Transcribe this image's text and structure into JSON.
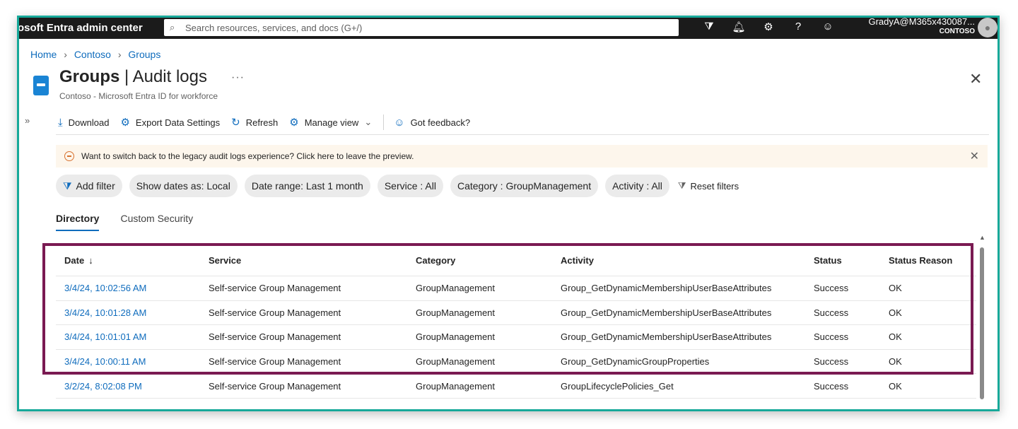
{
  "app": {
    "brand": "osoft Entra admin center",
    "search_placeholder": "Search resources, services, and docs (G+/)",
    "user_email": "GradyA@M365x430087...",
    "user_tenant": "CONTOSO"
  },
  "top_icons": [
    "filter-settings-icon",
    "notifications-icon",
    "settings-gear-icon",
    "help-icon",
    "feedback-person-icon"
  ],
  "breadcrumb": [
    "Home",
    "Contoso",
    "Groups"
  ],
  "page": {
    "title_main": "Groups",
    "title_sub": "Audit logs",
    "subtitle": "Contoso - Microsoft Entra ID for workforce"
  },
  "toolbar": {
    "download": "Download",
    "export": "Export Data Settings",
    "refresh": "Refresh",
    "manage_view": "Manage view",
    "feedback": "Got feedback?"
  },
  "banner": {
    "text": "Want to switch back to the legacy audit logs experience? Click here to leave the preview."
  },
  "filters": {
    "add": "Add filter",
    "dates": "Show dates as: Local",
    "range": "Date range: Last 1 month",
    "service": "Service : All",
    "category": "Category : GroupManagement",
    "activity": "Activity : All",
    "reset": "Reset filters"
  },
  "tabs": [
    "Directory",
    "Custom Security"
  ],
  "table": {
    "columns": [
      "Date",
      "Service",
      "Category",
      "Activity",
      "Status",
      "Status Reason"
    ],
    "rows": [
      [
        "3/4/24, 10:02:56 AM",
        "Self-service Group Management",
        "GroupManagement",
        "Group_GetDynamicMembershipUserBaseAttributes",
        "Success",
        "OK"
      ],
      [
        "3/4/24, 10:01:28 AM",
        "Self-service Group Management",
        "GroupManagement",
        "Group_GetDynamicMembershipUserBaseAttributes",
        "Success",
        "OK"
      ],
      [
        "3/4/24, 10:01:01 AM",
        "Self-service Group Management",
        "GroupManagement",
        "Group_GetDynamicMembershipUserBaseAttributes",
        "Success",
        "OK"
      ],
      [
        "3/4/24, 10:00:11 AM",
        "Self-service Group Management",
        "GroupManagement",
        "Group_GetDynamicGroupProperties",
        "Success",
        "OK"
      ],
      [
        "3/2/24, 8:02:08 PM",
        "Self-service Group Management",
        "GroupManagement",
        "GroupLifecyclePolicies_Get",
        "Success",
        "OK"
      ]
    ]
  },
  "colors": {
    "accent": "#0f6cbd",
    "frame_border": "#17a99a",
    "highlight_border": "#7a1a52",
    "warning": "#d8722f"
  }
}
